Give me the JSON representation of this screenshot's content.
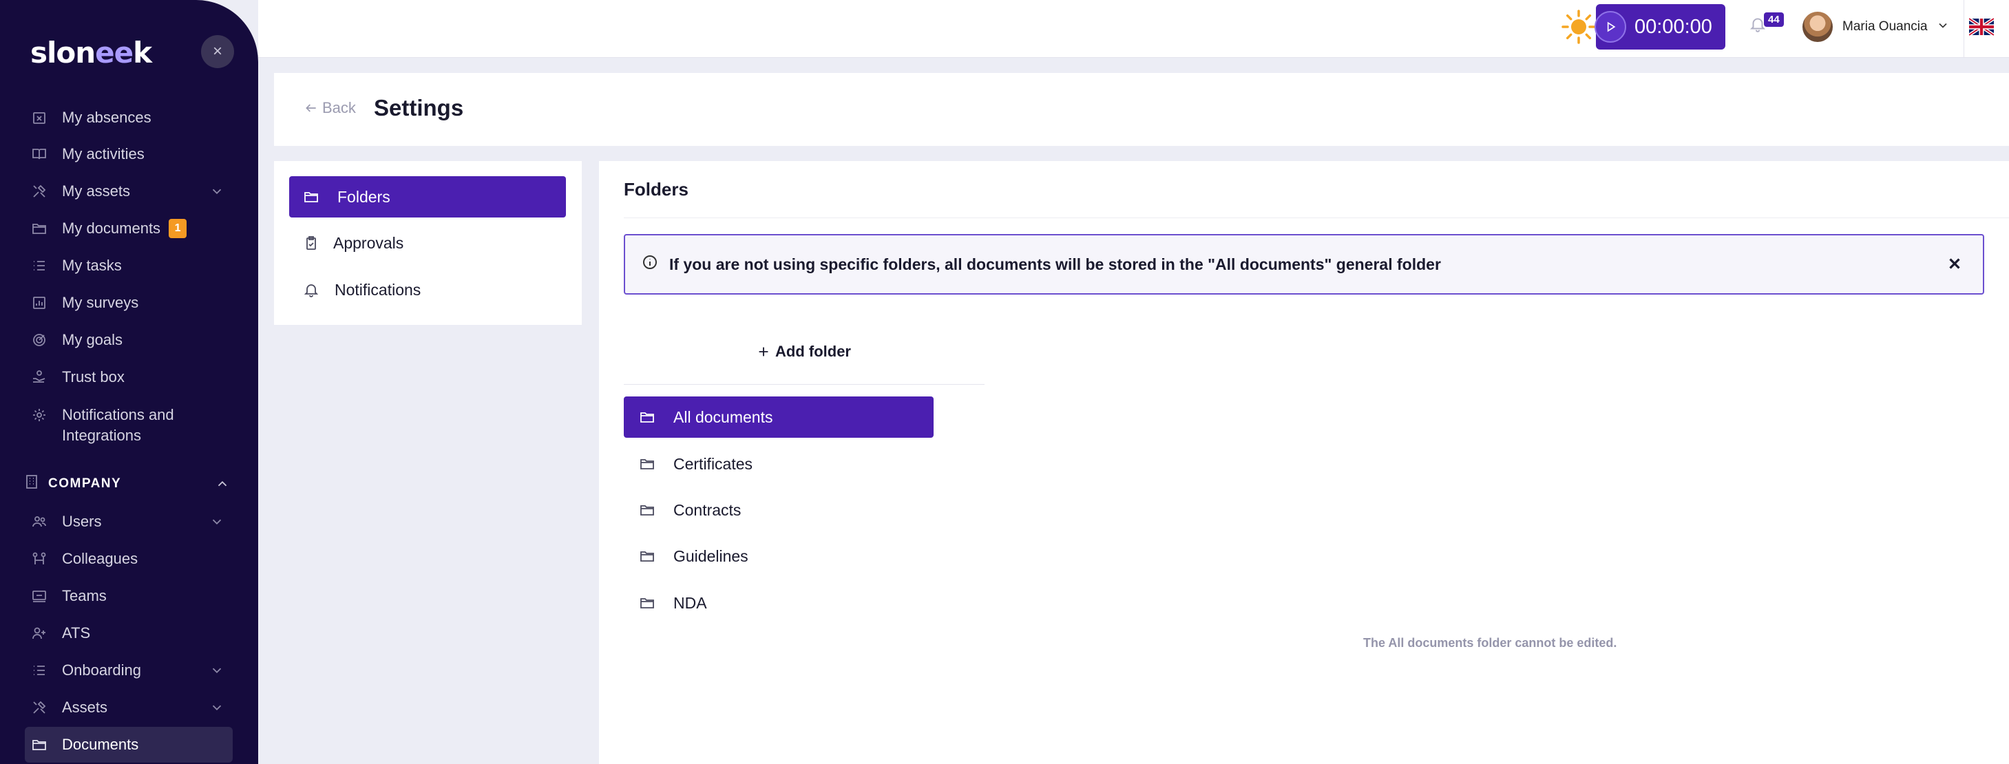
{
  "app": {
    "logo_text": "slon",
    "logo_accent": "ee",
    "logo_tail": "k"
  },
  "sidebar": {
    "items": [
      {
        "label": "My absences",
        "icon": "calendar-x-icon"
      },
      {
        "label": "My activities",
        "icon": "book-icon"
      },
      {
        "label": "My assets",
        "icon": "tools-icon",
        "chevron": true
      },
      {
        "label": "My documents",
        "icon": "folder-icon",
        "badge": "1"
      },
      {
        "label": "My tasks",
        "icon": "list-icon"
      },
      {
        "label": "My surveys",
        "icon": "chart-icon"
      },
      {
        "label": "My goals",
        "icon": "target-icon"
      },
      {
        "label": "Trust box",
        "icon": "hand-icon"
      },
      {
        "label": "Notifications and Integrations",
        "icon": "gear-icon"
      }
    ],
    "section": {
      "label": "COMPANY"
    },
    "company_items": [
      {
        "label": "Users",
        "icon": "users-icon",
        "chevron": true
      },
      {
        "label": "Colleagues",
        "icon": "colleagues-icon"
      },
      {
        "label": "Teams",
        "icon": "teams-icon"
      },
      {
        "label": "ATS",
        "icon": "user-plus-icon"
      },
      {
        "label": "Onboarding",
        "icon": "list-icon",
        "chevron": true
      },
      {
        "label": "Assets",
        "icon": "tools-icon",
        "chevron": true
      },
      {
        "label": "Documents",
        "icon": "folder-icon",
        "active": true
      }
    ]
  },
  "topbar": {
    "timer": "00:00:00",
    "notifications_count": "44",
    "user_name": "Maria Ouancia"
  },
  "header": {
    "back_label": "Back",
    "title": "Settings"
  },
  "settings_menu": [
    {
      "label": "Folders",
      "icon": "folder-icon",
      "active": true
    },
    {
      "label": "Approvals",
      "icon": "clipboard-icon"
    },
    {
      "label": "Notifications",
      "icon": "bell-icon"
    }
  ],
  "main": {
    "title": "Folders",
    "info_text": "If you are not using specific folders, all documents will be stored in the \"All documents\" general folder",
    "add_folder_label": "Add folder",
    "folders": [
      {
        "label": "All documents",
        "active": true
      },
      {
        "label": "Certificates"
      },
      {
        "label": "Contracts"
      },
      {
        "label": "Guidelines"
      },
      {
        "label": "NDA"
      }
    ],
    "hint": "The All documents folder cannot be edited."
  }
}
